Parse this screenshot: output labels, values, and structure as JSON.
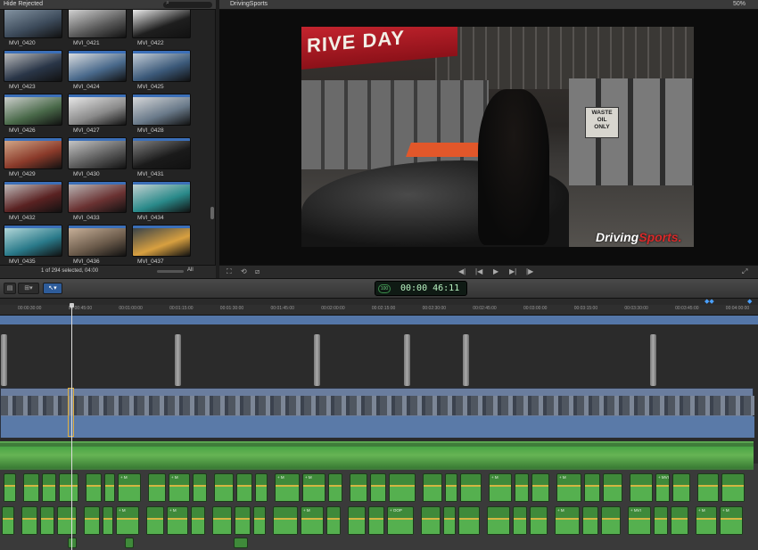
{
  "browser": {
    "filter": "Hide Rejected",
    "clips": [
      {
        "name": "MVI_0420",
        "c1": "#3c4a5a",
        "c2": "#8a9aa8"
      },
      {
        "name": "MVI_0421",
        "c1": "#5a5a5a",
        "c2": "#dcdcdc"
      },
      {
        "name": "MVI_0422",
        "c1": "#1e1e1e",
        "c2": "#ffffff"
      },
      {
        "name": "MVI_0423",
        "c1": "#2a3648",
        "c2": "#c7c7c7"
      },
      {
        "name": "MVI_0424",
        "c1": "#4a6a8c",
        "c2": "#e8e8e8"
      },
      {
        "name": "MVI_0425",
        "c1": "#3c5a7a",
        "c2": "#d0d8e0"
      },
      {
        "name": "MVI_0426",
        "c1": "#4a6a4a",
        "c2": "#d8d8d8"
      },
      {
        "name": "MVI_0427",
        "c1": "#8a8a8a",
        "c2": "#f0f0f0"
      },
      {
        "name": "MVI_0428",
        "c1": "#6a7a8a",
        "c2": "#e0e0e0"
      },
      {
        "name": "MVI_0429",
        "c1": "#8a3a2a",
        "c2": "#d8b090"
      },
      {
        "name": "MVI_0430",
        "c1": "#5a5a5a",
        "c2": "#cfcfcf"
      },
      {
        "name": "MVI_0431",
        "c1": "#1a1a1a",
        "c2": "#8a8a8a"
      },
      {
        "name": "MVI_0432",
        "c1": "#5a2222",
        "c2": "#c9c9c9"
      },
      {
        "name": "MVI_0433",
        "c1": "#6a3232",
        "c2": "#c0c0c0"
      },
      {
        "name": "MVI_0434",
        "c1": "#2a8a8a",
        "c2": "#d0d8d8"
      },
      {
        "name": "MVI_0435",
        "c1": "#2a7a8a",
        "c2": "#bfe0e0"
      },
      {
        "name": "MVI_0436",
        "c1": "#6a5a4a",
        "c2": "#d0b8a0"
      },
      {
        "name": "MVI_0437",
        "c1": "#d8a040",
        "c2": "#2a3a4a"
      },
      {
        "name": "",
        "c1": "#3a4a6a",
        "c2": "#8aa0c0"
      },
      {
        "name": "",
        "c1": "#4a5a7a",
        "c2": "#d8a040"
      },
      {
        "name": "",
        "c1": "#3a5a8a",
        "c2": "#a0b8d0"
      }
    ],
    "selection_status": "1 of 294 selected, 04:00",
    "all_label": "All"
  },
  "viewer": {
    "title": "DrivingSports",
    "zoom": "50%",
    "frame": {
      "banner": "RIVE DAY",
      "sign_lines": [
        "WASTE",
        "OIL",
        "ONLY"
      ],
      "watermark_a": "Driving",
      "watermark_b": "Sports."
    }
  },
  "toolbar": {
    "timecode_badge": "100",
    "timecode": "00:00 46:11"
  },
  "timeline": {
    "ruler_ticks": [
      "00:00:30:00",
      "00:00:45:00",
      "00:01:00:00",
      "00:01:15:00",
      "00:01:30:00",
      "00:01:45:00",
      "00:02:00:00",
      "00:02:15:00",
      "00:02:30:00",
      "00:02:45:00",
      "00:03:00:00",
      "00:03:15:00",
      "00:03:30:00",
      "00:03:45:00",
      "00:04:00:00"
    ],
    "audio_clip_labels": [
      "",
      "",
      "",
      "",
      "",
      "",
      "+ M",
      "",
      "+ M",
      "",
      "",
      "",
      "",
      "+ M",
      "+ M",
      "",
      "",
      "",
      "",
      "",
      "",
      "",
      "+ M",
      "",
      "",
      "+ M",
      "",
      "",
      "",
      "+ MVI",
      "",
      "",
      "",
      "+ M",
      "",
      "",
      "",
      "+ M",
      "+ M"
    ],
    "audio_clip_labels_lower": [
      "",
      "",
      "",
      "",
      "",
      "",
      "+ M",
      "",
      "+ M",
      "",
      "",
      "",
      "",
      "",
      "+ M",
      "",
      "",
      "",
      "+ OOP",
      "",
      "",
      "",
      "",
      "",
      "",
      "+ M",
      "",
      "",
      "+ MVI",
      "",
      "",
      "+ M",
      "+ M",
      "",
      "",
      "+ M",
      "+ M"
    ]
  }
}
